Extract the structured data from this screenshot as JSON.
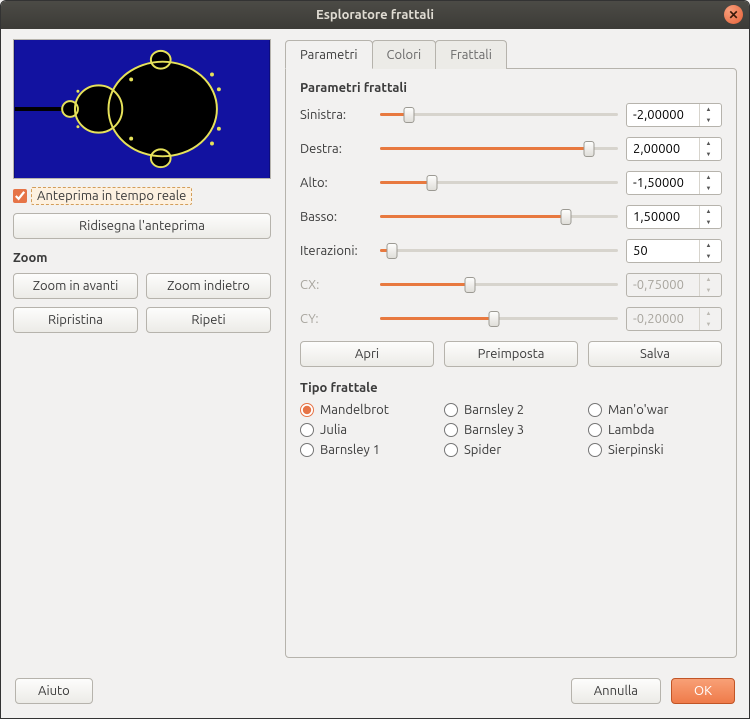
{
  "window": {
    "title": "Esploratore frattali"
  },
  "preview": {
    "realtime_label": "Anteprima in tempo reale",
    "realtime_checked": true,
    "redraw_label": "Ridisegna l'anteprima"
  },
  "zoom": {
    "title": "Zoom",
    "in": "Zoom in avanti",
    "out": "Zoom indietro",
    "reset": "Ripristina",
    "redo": "Ripeti"
  },
  "tabs": {
    "parametri": "Parametri",
    "colori": "Colori",
    "frattali": "Frattali"
  },
  "params": {
    "group_title": "Parametri frattali",
    "rows": {
      "sinistra": {
        "label": "Sinistra:",
        "value": "-2,00000",
        "fill": 12
      },
      "destra": {
        "label": "Destra:",
        "value": "2,00000",
        "fill": 88
      },
      "alto": {
        "label": "Alto:",
        "value": "-1,50000",
        "fill": 22
      },
      "basso": {
        "label": "Basso:",
        "value": "1,50000",
        "fill": 78
      },
      "iter": {
        "label": "Iterazioni:",
        "value": "50",
        "fill": 5
      },
      "cx": {
        "label": "CX:",
        "value": "-0,75000",
        "fill": 38
      },
      "cy": {
        "label": "CY:",
        "value": "-0,20000",
        "fill": 48
      }
    },
    "actions": {
      "open": "Apri",
      "preset": "Preimposta",
      "save": "Salva"
    }
  },
  "fractal_type": {
    "title": "Tipo frattale",
    "options": [
      {
        "label": "Mandelbrot",
        "checked": true
      },
      {
        "label": "Barnsley 2",
        "checked": false
      },
      {
        "label": "Man'o'war",
        "checked": false
      },
      {
        "label": "Julia",
        "checked": false
      },
      {
        "label": "Barnsley 3",
        "checked": false
      },
      {
        "label": "Lambda",
        "checked": false
      },
      {
        "label": "Barnsley 1",
        "checked": false
      },
      {
        "label": "Spider",
        "checked": false
      },
      {
        "label": "Sierpinski",
        "checked": false
      }
    ]
  },
  "footer": {
    "help": "Aiuto",
    "cancel": "Annulla",
    "ok": "OK"
  },
  "colors": {
    "accent": "#e8793f",
    "bg": "#f2f1f0"
  }
}
